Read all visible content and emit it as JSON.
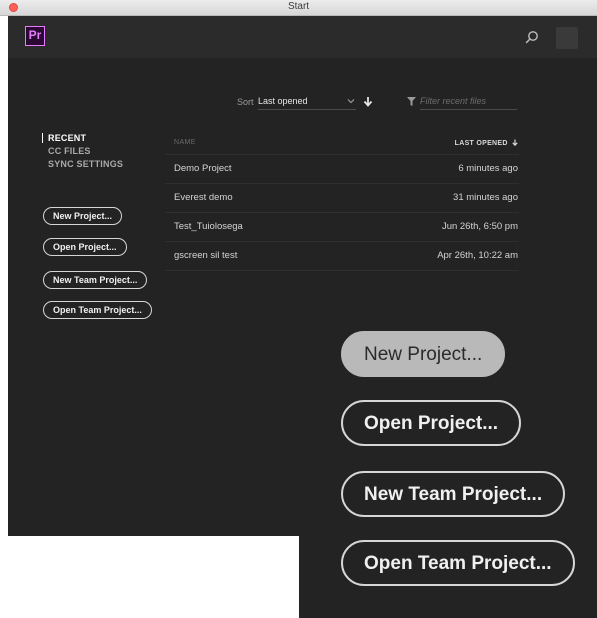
{
  "window": {
    "title": "Start"
  },
  "header": {
    "logo_text": "Pr"
  },
  "sidebar": {
    "nav": [
      {
        "label": "RECENT",
        "active": true
      },
      {
        "label": "CC FILES",
        "active": false
      },
      {
        "label": "SYNC SETTINGS",
        "active": false
      }
    ],
    "buttons": {
      "new_project": "New Project...",
      "open_project": "Open Project...",
      "new_team_project": "New Team Project...",
      "open_team_project": "Open Team Project..."
    }
  },
  "toolbar": {
    "sort_label": "Sort",
    "sort_value": "Last opened",
    "filter_placeholder": "Filter recent files"
  },
  "table": {
    "columns": {
      "name": "NAME",
      "last_opened": "LAST OPENED"
    },
    "rows": [
      {
        "name": "Demo Project",
        "last_opened": "6 minutes ago"
      },
      {
        "name": "Everest demo",
        "last_opened": "31 minutes ago"
      },
      {
        "name": "Test_Tuiolosega",
        "last_opened": "Jun 26th, 6:50 pm"
      },
      {
        "name": "gscreen sil test",
        "last_opened": "Apr 26th, 10:22 am"
      }
    ]
  },
  "zoom_inset": {
    "new_project": "New Project...",
    "open_project": "Open Project...",
    "new_team_project": "New Team Project...",
    "open_team_project": "Open Team Project..."
  },
  "colors": {
    "background": "#232323",
    "header": "#2b2b2b",
    "accent_premiere": "#e77bff",
    "button_border": "#d6d6d6",
    "highlight_fill": "#b9b9b9"
  }
}
